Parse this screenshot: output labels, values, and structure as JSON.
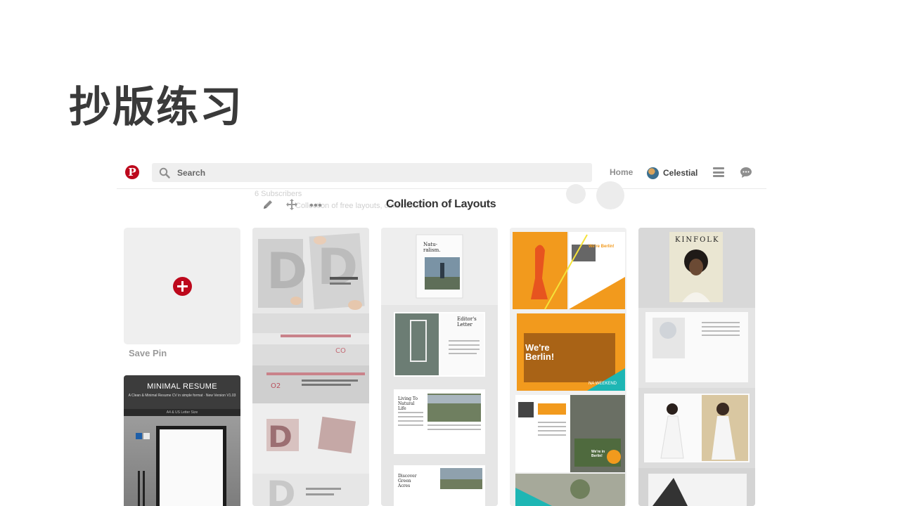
{
  "slide": {
    "title": "抄版练习"
  },
  "topbar": {
    "search_placeholder": "Search",
    "home_label": "Home",
    "user_name": "Celestial"
  },
  "board": {
    "title": "Collection of Layouts",
    "ghost_count": "6 Subscribers",
    "ghost_desc": "Collection of free layouts, collections"
  },
  "pins": {
    "save_pin_label": "Save Pin",
    "resume": {
      "title": "MINIMAL RESUME",
      "subtitle": "A Clean & Minimal Resume CV in simple format · New Version V1.03",
      "band": "A4 & US Letter Size"
    },
    "magazine_cover_title": "Natu-ralism.",
    "magazine_editor": "Editor's Letter",
    "magazine_living": "Living To Natural Life",
    "magazine_discover": "Discover Green Acres",
    "berlin_header": "We're Berlin!",
    "berlin_big": "We're Berlin!",
    "berlin_weekend": "NA WEEKEND",
    "berlin_small": "We're in Berlin!",
    "kinfolk_title": "KINFOLK"
  },
  "colors": {
    "pinterest_red": "#bd081c",
    "search_bg": "#efefef",
    "orange": "#f29a1d",
    "teal": "#1eb6b4"
  }
}
